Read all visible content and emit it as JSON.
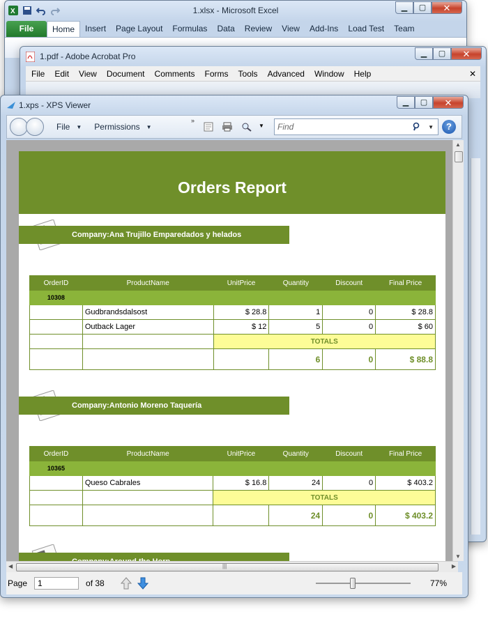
{
  "excel": {
    "title": "1.xlsx  -  Microsoft Excel",
    "file_tab": "File",
    "tabs": [
      "Home",
      "Insert",
      "Page Layout",
      "Formulas",
      "Data",
      "Review",
      "View",
      "Add-Ins",
      "Load Test",
      "Team"
    ]
  },
  "acrobat": {
    "title": "1.pdf - Adobe Acrobat Pro",
    "menu": [
      "File",
      "Edit",
      "View",
      "Document",
      "Comments",
      "Forms",
      "Tools",
      "Advanced",
      "Window",
      "Help"
    ]
  },
  "xps": {
    "title": "1.xps - XPS Viewer",
    "menu_file": "File",
    "menu_permissions": "Permissions",
    "find_placeholder": "Find",
    "help_label": "?",
    "status": {
      "page_label": "Page",
      "page_value": "1",
      "of_label": "of 38",
      "zoom": "77%"
    },
    "zoom_fraction": 0.38
  },
  "report": {
    "title": "Orders Report",
    "columns": [
      "OrderID",
      "ProductName",
      "UnitPrice",
      "Quantity",
      "Discount",
      "Final Price"
    ],
    "totals_label": "TOTALS",
    "companies": [
      {
        "name": "Company:Ana Trujillo Emparedados y helados",
        "order_id": "10308",
        "items": [
          {
            "product": "Gudbrandsdalsost",
            "unit_price": "$ 28.8",
            "quantity": "1",
            "discount": "0",
            "final_price": "$ 28.8"
          },
          {
            "product": "Outback Lager",
            "unit_price": "$ 12",
            "quantity": "5",
            "discount": "0",
            "final_price": "$ 60"
          }
        ],
        "totals": {
          "quantity": "6",
          "discount": "0",
          "final_price": "$ 88.8"
        }
      },
      {
        "name": "Company:Antonio Moreno Taquería",
        "order_id": "10365",
        "items": [
          {
            "product": "Queso Cabrales",
            "unit_price": "$ 16.8",
            "quantity": "24",
            "discount": "0",
            "final_price": "$ 403.2"
          }
        ],
        "totals": {
          "quantity": "24",
          "discount": "0",
          "final_price": "$ 403.2"
        }
      },
      {
        "name": "Company:Around the Horn"
      }
    ]
  },
  "colors": {
    "report_green": "#6f8f2a",
    "id_row_green": "#8bb43a",
    "totals_yellow": "#fdfc97"
  }
}
